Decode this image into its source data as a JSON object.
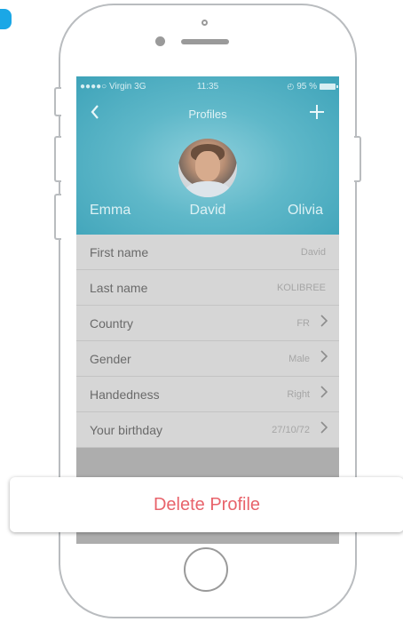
{
  "status_bar": {
    "carrier": "●●●●○ Virgin  3G",
    "time": "11:35",
    "battery": "95 %"
  },
  "nav": {
    "back_icon": "chevron-left-icon",
    "title": "Profiles",
    "add_icon": "plus-icon"
  },
  "profiles": {
    "left": "Emma",
    "center": "David",
    "right": "Olivia"
  },
  "fields": [
    {
      "label": "First name",
      "value": "David"
    },
    {
      "label": "Last name",
      "value": "KOLIBREE"
    },
    {
      "label": "Country",
      "value": "FR"
    },
    {
      "label": "Gender",
      "value": "Male"
    },
    {
      "label": "Handedness",
      "value": "Right"
    },
    {
      "label": "Your birthday",
      "value": "27/10/72"
    }
  ],
  "delete_button": "Delete Profile",
  "colors": {
    "accent": "#4fb3c7",
    "delete": "#e8636b"
  }
}
